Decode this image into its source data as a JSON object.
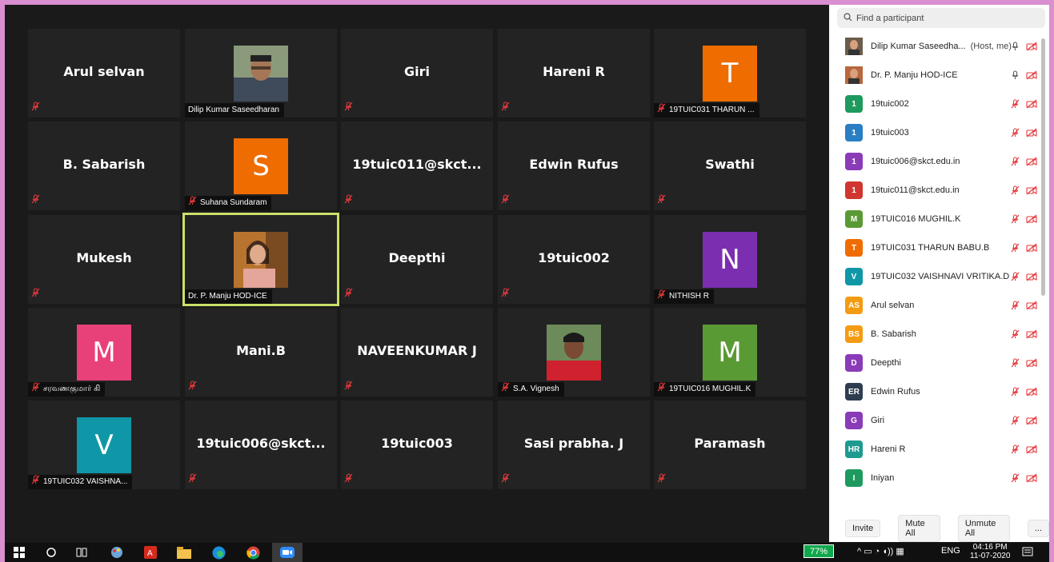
{
  "gallery": {
    "tiles": [
      {
        "kind": "name",
        "big": "Arul selvan",
        "label": ""
      },
      {
        "kind": "photo",
        "big": "",
        "label": "Dilip Kumar Saseedharan",
        "photo": "man"
      },
      {
        "kind": "name",
        "big": "Giri",
        "label": ""
      },
      {
        "kind": "name",
        "big": "Hareni R",
        "label": ""
      },
      {
        "kind": "avatar",
        "big": "T",
        "label": "19TUIC031 THARUN ...",
        "color": "#ef6c00"
      },
      {
        "kind": "name",
        "big": "B. Sabarish",
        "label": ""
      },
      {
        "kind": "avatar",
        "big": "S",
        "label": "Suhana Sundaram",
        "color": "#ef6c00"
      },
      {
        "kind": "name",
        "big": "19tuic011@skct...",
        "label": ""
      },
      {
        "kind": "name",
        "big": "Edwin Rufus",
        "label": ""
      },
      {
        "kind": "name",
        "big": "Swathi",
        "label": ""
      },
      {
        "kind": "name",
        "big": "Mukesh",
        "label": ""
      },
      {
        "kind": "photo",
        "big": "",
        "label": "Dr. P. Manju HOD-ICE",
        "photo": "woman",
        "active": true
      },
      {
        "kind": "name",
        "big": "Deepthi",
        "label": ""
      },
      {
        "kind": "name",
        "big": "19tuic002",
        "label": ""
      },
      {
        "kind": "avatar",
        "big": "N",
        "label": "NITHISH R",
        "color": "#7b2fb0"
      },
      {
        "kind": "avatar",
        "big": "M",
        "label": "சரவணகுமார் கி",
        "color": "#e8417a"
      },
      {
        "kind": "name",
        "big": "Mani.B",
        "label": ""
      },
      {
        "kind": "name",
        "big": "NAVEENKUMAR J",
        "label": ""
      },
      {
        "kind": "photo",
        "big": "",
        "label": "S.A. Vignesh",
        "photo": "boy"
      },
      {
        "kind": "avatar",
        "big": "M",
        "label": "19TUIC016 MUGHIL.K",
        "color": "#5a9a35"
      },
      {
        "kind": "avatar",
        "big": "V",
        "label": "19TUIC032 VAISHNA...",
        "color": "#0f97a7"
      },
      {
        "kind": "name",
        "big": "19tuic006@skct...",
        "label": ""
      },
      {
        "kind": "name",
        "big": "19tuic003",
        "label": ""
      },
      {
        "kind": "name",
        "big": "Sasi prabha. J",
        "label": ""
      },
      {
        "kind": "name",
        "big": "Paramash",
        "label": ""
      }
    ]
  },
  "panel": {
    "search_placeholder": "Find a participant",
    "host_note": "(Host, me)",
    "participants": [
      {
        "name": "Dilip Kumar Saseedha...",
        "initials": "",
        "color": "#6d5b4b",
        "photo": true,
        "host": true,
        "mic": "on"
      },
      {
        "name": "Dr. P. Manju HOD-ICE",
        "initials": "",
        "color": "#b8673e",
        "photo": true,
        "host": false,
        "mic": "on"
      },
      {
        "name": "19tuic002",
        "initials": "1",
        "color": "#1f9a5e",
        "host": false,
        "mic": "off"
      },
      {
        "name": "19tuic003",
        "initials": "1",
        "color": "#2a7ec4",
        "host": false,
        "mic": "off"
      },
      {
        "name": "19tuic006@skct.edu.in",
        "initials": "1",
        "color": "#8a3bb8",
        "host": false,
        "mic": "off"
      },
      {
        "name": "19tuic011@skct.edu.in",
        "initials": "1",
        "color": "#d0352f",
        "host": false,
        "mic": "off"
      },
      {
        "name": "19TUIC016 MUGHIL.K",
        "initials": "M",
        "color": "#5a9a35",
        "host": false,
        "mic": "off"
      },
      {
        "name": "19TUIC031 THARUN BABU.B",
        "initials": "T",
        "color": "#ef6c00",
        "host": false,
        "mic": "off"
      },
      {
        "name": "19TUIC032 VAISHNAVI VRITIKA.D",
        "initials": "V",
        "color": "#0f97a7",
        "host": false,
        "mic": "off"
      },
      {
        "name": "Arul selvan",
        "initials": "AS",
        "color": "#f39c12",
        "host": false,
        "mic": "off"
      },
      {
        "name": "B. Sabarish",
        "initials": "BS",
        "color": "#f39c12",
        "host": false,
        "mic": "off"
      },
      {
        "name": "Deepthi",
        "initials": "D",
        "color": "#8a3bb8",
        "host": false,
        "mic": "off"
      },
      {
        "name": "Edwin Rufus",
        "initials": "ER",
        "color": "#2f3e4f",
        "host": false,
        "mic": "off"
      },
      {
        "name": "Giri",
        "initials": "G",
        "color": "#8a3bb8",
        "host": false,
        "mic": "off"
      },
      {
        "name": "Hareni R",
        "initials": "HR",
        "color": "#1f9a8f",
        "host": false,
        "mic": "off"
      },
      {
        "name": "Iniyan",
        "initials": "I",
        "color": "#1f9a5e",
        "host": false,
        "mic": "off"
      }
    ],
    "buttons": {
      "invite": "Invite",
      "mute_all": "Mute All",
      "unmute_all": "Unmute All",
      "more": "..."
    }
  },
  "taskbar": {
    "battery": "77%",
    "lang": "ENG",
    "time": "04:16 PM",
    "date": "11-07-2020"
  },
  "colors": {
    "active_border": "#c9e06a",
    "mic_off": "#e5393c"
  }
}
